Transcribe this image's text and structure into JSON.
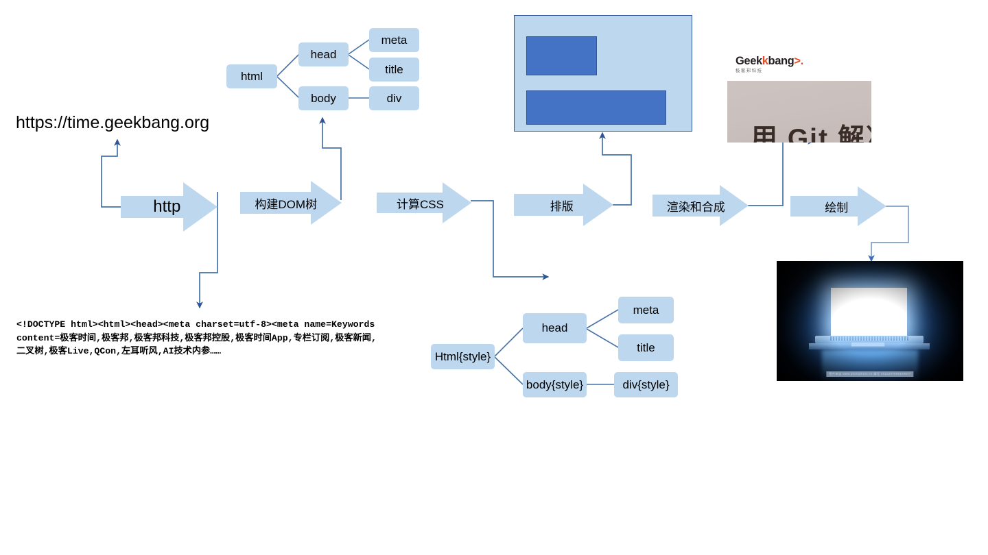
{
  "diagram": {
    "title": "browser-rendering-pipeline",
    "colors": {
      "arrow_fill": "#bdd7ee",
      "node_fill": "#bdd7ee",
      "connector_stroke": "#4472a8",
      "connector_stroke_dark": "#2f5597",
      "wireframe_block": "#4472c4",
      "wireframe_border": "#2f5597",
      "brand_orange": "#e8491f"
    }
  },
  "url": {
    "text": "https://time.geekbang.org"
  },
  "source_code": {
    "text": "<!DOCTYPE html><html><head><meta charset=utf-8><meta name=Keywords content=极客时间,极客邦,极客邦科技,极客邦控股,极客时间App,专栏订阅,极客新闻,二叉树,极客Live,QCon,左耳听风,AI技术内参……"
  },
  "pipeline": {
    "steps": [
      {
        "id": "http",
        "label": "http"
      },
      {
        "id": "build-dom",
        "label": "构建DOM树"
      },
      {
        "id": "compute-css",
        "label": "计算CSS"
      },
      {
        "id": "layout",
        "label": "排版"
      },
      {
        "id": "render-composite",
        "label": "渲染和合成"
      },
      {
        "id": "paint",
        "label": "绘制"
      }
    ]
  },
  "dom_tree": {
    "caption": "dom-tree",
    "nodes": [
      {
        "id": "html",
        "label": "html"
      },
      {
        "id": "head",
        "label": "head"
      },
      {
        "id": "body",
        "label": "body"
      },
      {
        "id": "meta",
        "label": "meta"
      },
      {
        "id": "title",
        "label": "title"
      },
      {
        "id": "div",
        "label": "div"
      }
    ]
  },
  "style_tree": {
    "caption": "styled-dom-tree",
    "nodes": [
      {
        "id": "html-style",
        "label": "Html{style}"
      },
      {
        "id": "head",
        "label": "head"
      },
      {
        "id": "body-style",
        "label": "body{style}"
      },
      {
        "id": "meta",
        "label": "meta"
      },
      {
        "id": "title",
        "label": "title"
      },
      {
        "id": "div-style",
        "label": "div{style}"
      }
    ]
  },
  "layout_preview": {
    "caption": "layout-wireframe",
    "blocks": 2
  },
  "rendered_page": {
    "logo_part1": "Geek",
    "logo_k": "k",
    "logo_part2": "bang",
    "logo_arrow": ">.",
    "logo_subtitle": "极客邦科技",
    "card_title": "用 Git 解决"
  },
  "painted_screen": {
    "caption": "laptop-display-photo",
    "watermark": "图片来自 www.photophoto.cn  编号 2015297905109947"
  }
}
